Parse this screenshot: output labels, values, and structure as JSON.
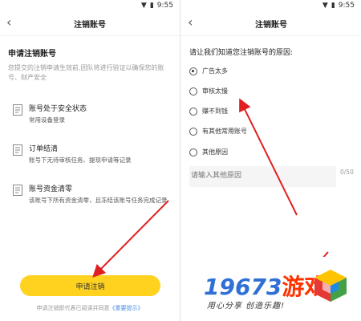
{
  "status": {
    "time": "9:55"
  },
  "left": {
    "nav_title": "注销账号",
    "section_title": "申请注销账号",
    "description": "您提交的注销申请生效前,团队将进行验证以确保您的账号、财产安全",
    "items": [
      {
        "title": "账号处于安全状态",
        "subtitle": "常用设备登录"
      },
      {
        "title": "订单结清",
        "subtitle": "账号下无待审核任务、提现申请等记录"
      },
      {
        "title": "账号资金清零",
        "subtitle": "该账号下所有资金清零，且冻结该账号任务完成记录"
      }
    ],
    "button_label": "申请注销",
    "agreement_prefix": "申请注销即代表已阅读并同意",
    "agreement_link": "《重要提示》"
  },
  "right": {
    "nav_title": "注销账号",
    "question": "请让我们知道您注销账号的原因:",
    "options": [
      {
        "label": "广告太多",
        "selected": true
      },
      {
        "label": "审核太慢",
        "selected": false
      },
      {
        "label": "赚不到钱",
        "selected": false
      },
      {
        "label": "有其他常用账号",
        "selected": false
      },
      {
        "label": "其他原因",
        "selected": false
      }
    ],
    "input_placeholder": "请输入其他原因",
    "counter": "0/50"
  },
  "watermark": {
    "number": "19673",
    "brand": "游戏",
    "slogan": "用心分享  创造乐趣!"
  },
  "colors": {
    "button": "#ffd21f",
    "arrow": "#e02020",
    "link": "#4a8ee6"
  }
}
